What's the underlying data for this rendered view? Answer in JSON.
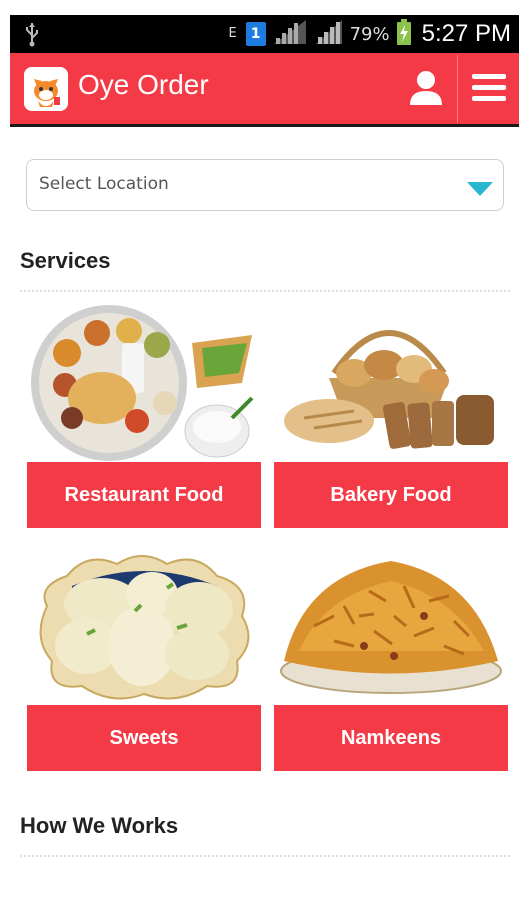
{
  "status_bar": {
    "signal_type": "E",
    "sim_badge": "1",
    "battery_percent": "79%",
    "time": "5:27 PM"
  },
  "app_bar": {
    "title": "Oye Order",
    "icons": [
      "cat-logo-icon",
      "user-icon",
      "hamburger-menu-icon"
    ]
  },
  "location": {
    "placeholder": "Select Location"
  },
  "sections": {
    "services_title": "Services",
    "how_title": "How We Works"
  },
  "services": [
    {
      "label": "Restaurant Food"
    },
    {
      "label": "Bakery Food"
    },
    {
      "label": "Sweets"
    },
    {
      "label": "Namkeens"
    }
  ],
  "colors": {
    "brand": "#f53a47",
    "caret": "#29b6d0"
  }
}
